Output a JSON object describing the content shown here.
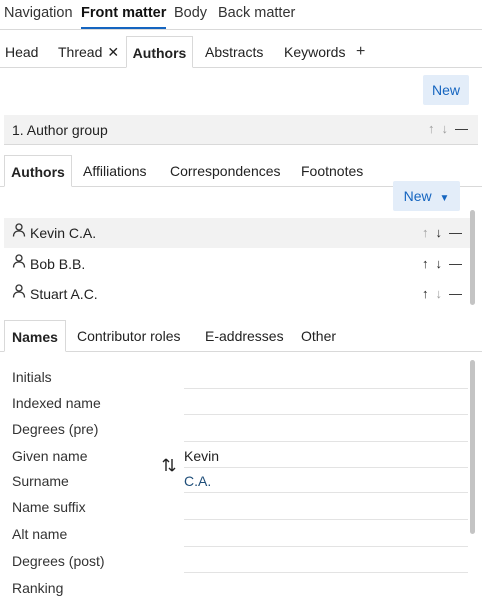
{
  "top_nav": {
    "items": [
      "Navigation",
      "Front matter",
      "Body",
      "Back matter"
    ],
    "active": "Front matter"
  },
  "sub_tabs": {
    "items": [
      "Head",
      "Thread",
      "Authors",
      "Abstracts",
      "Keywords"
    ],
    "closable": "Thread",
    "active": "Authors",
    "add_icon": "plus-icon"
  },
  "new_button_label": "New",
  "author_group": {
    "title": "1. Author group"
  },
  "section_tabs": {
    "items": [
      "Authors",
      "Affiliations",
      "Correspondences",
      "Footnotes"
    ],
    "active": "Authors"
  },
  "new_dropdown": {
    "label": "New",
    "icon": "caret-down-icon"
  },
  "authors": [
    {
      "name": "Kevin C.A.",
      "selected": true
    },
    {
      "name": "Bob B.B.",
      "selected": false
    },
    {
      "name": "Stuart A.C.",
      "selected": false
    }
  ],
  "detail_tabs": {
    "items": [
      "Names",
      "Contributor roles",
      "E-addresses",
      "Other"
    ],
    "active": "Names"
  },
  "name_fields": [
    {
      "label": "Initials",
      "value": ""
    },
    {
      "label": "Indexed name",
      "value": ""
    },
    {
      "label": "Degrees (pre)",
      "value": ""
    },
    {
      "label": "Given name",
      "value": "Kevin"
    },
    {
      "label": "Surname",
      "value": "C.A."
    },
    {
      "label": "Name suffix",
      "value": ""
    },
    {
      "label": "Alt name",
      "value": ""
    },
    {
      "label": "Degrees (post)",
      "value": ""
    },
    {
      "label": "Ranking",
      "value": ""
    }
  ],
  "colors": {
    "accent": "#1565c0",
    "button_bg": "#e3edf9",
    "selected_row": "#f2f2f2",
    "surname_value": "#1f4e79"
  }
}
